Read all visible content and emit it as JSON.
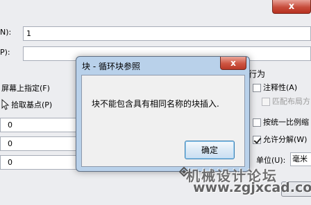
{
  "window": {
    "close_glyph": "x",
    "name_label_fragment": "N):",
    "name_value": "1",
    "path_label_fragment": "P):",
    "path_value": ""
  },
  "insert_point": {
    "specify_onscreen_label": "屏幕上指定(F)",
    "pick_point_label": "拾取基点(P)",
    "x_value": "0",
    "y_value": "0",
    "z_value": "0"
  },
  "behavior": {
    "section_label": "行为",
    "annotative_label": "注释性(A)",
    "annotative_checked": false,
    "match_orientation_label": "匹配布局方",
    "match_orientation_checked": false,
    "uniform_scale_label": "按统一比例缩",
    "uniform_scale_checked": false,
    "allow_explode_label": "允许分解(W)",
    "allow_explode_checked": true
  },
  "units": {
    "label": "单位(U):",
    "value": "毫米"
  },
  "dialog": {
    "title": "块 - 循环块参照",
    "close_glyph": "x",
    "message": "块不能包含具有相同名称的块插入.",
    "ok_label": "确定"
  },
  "watermark": {
    "site_name": "机械设计论坛",
    "url": "www.zgjxcad.com"
  },
  "icons": [
    "close-icon",
    "pick-point-icon",
    "dialog-close-icon",
    "watermark-logo-icon"
  ]
}
